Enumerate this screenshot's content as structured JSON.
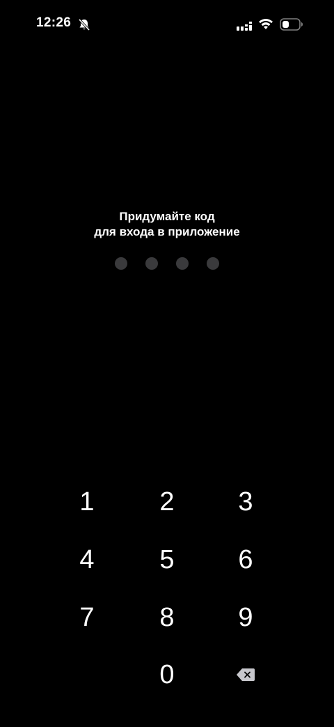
{
  "status_bar": {
    "time": "12:26",
    "icons": [
      "bell-muted-icon",
      "signal-icon",
      "wifi-icon",
      "battery-icon"
    ]
  },
  "prompt": {
    "line1": "Придумайте код",
    "line2": "для входа в приложение"
  },
  "pin": {
    "length": 4,
    "entered": 0,
    "dot_color": "#3a3a3c"
  },
  "keypad": {
    "keys": [
      "1",
      "2",
      "3",
      "4",
      "5",
      "6",
      "7",
      "8",
      "9",
      "0"
    ],
    "delete_icon": "backspace-icon"
  },
  "colors": {
    "background": "#000000",
    "text": "#ffffff"
  }
}
